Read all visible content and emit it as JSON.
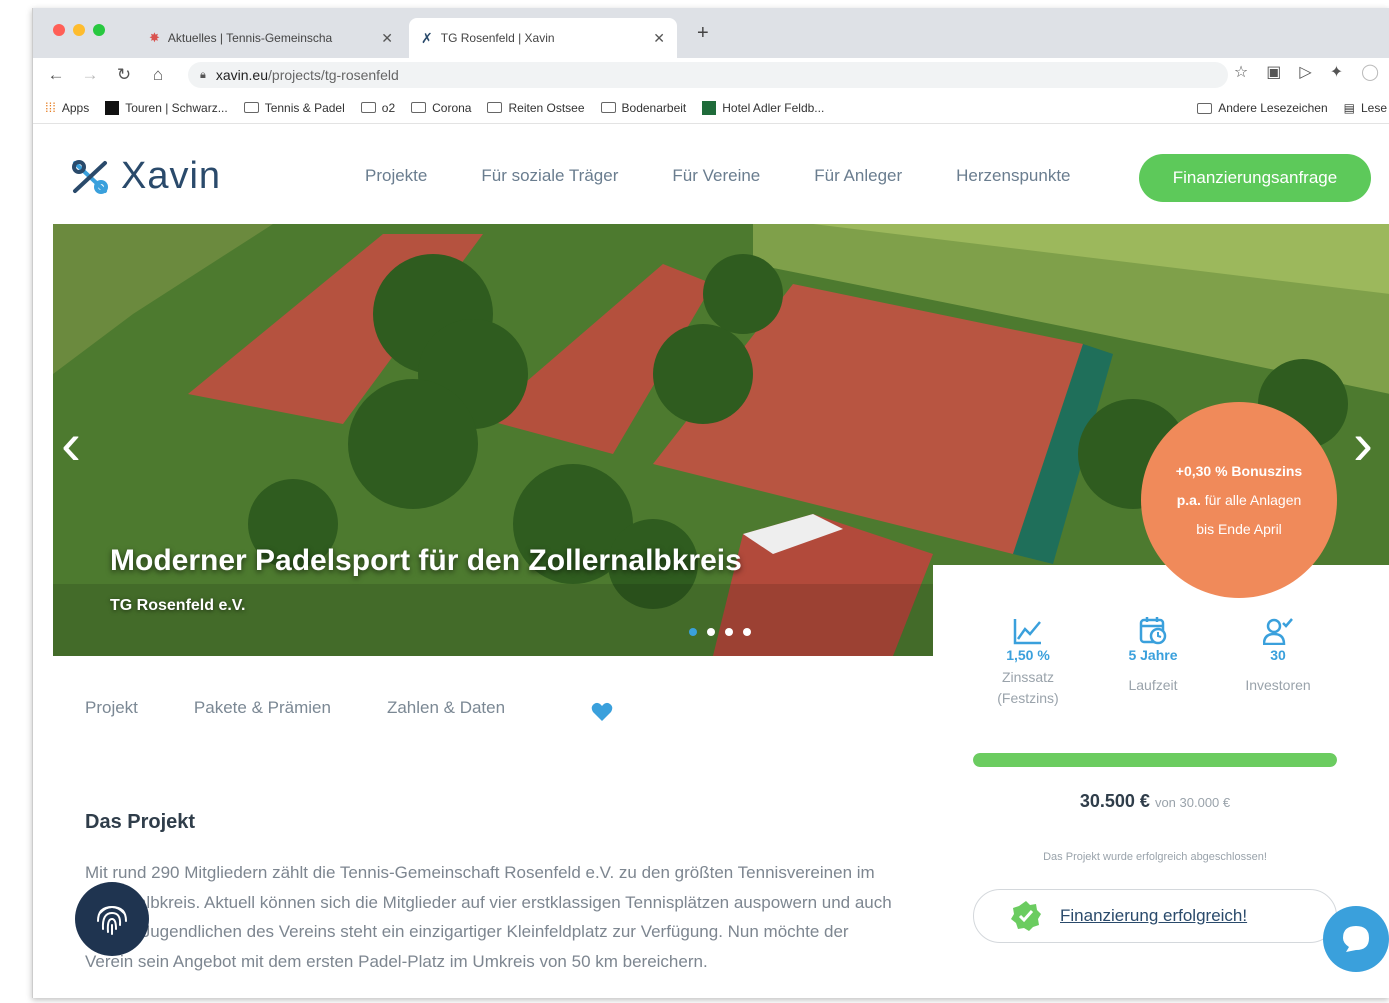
{
  "browser": {
    "tabs": [
      {
        "title": "Aktuelles | Tennis-Gemeinscha"
      },
      {
        "title": "TG Rosenfeld | Xavin"
      }
    ],
    "new_tab": "+",
    "url_host": "xavin.eu",
    "url_path": "/projects/tg-rosenfeld",
    "bookmarks": [
      "Apps",
      "Touren | Schwarz...",
      "Tennis & Padel",
      "o2",
      "Corona",
      "Reiten Ostsee",
      "Bodenarbeit",
      "Hotel Adler Feldb..."
    ],
    "bookmarks_right": [
      "Andere Lesezeichen",
      "Lese"
    ]
  },
  "site": {
    "logo": "Xavin",
    "nav": [
      "Projekte",
      "Für soziale Träger",
      "Für Vereine",
      "Für Anleger",
      "Herzenspunkte"
    ],
    "cta": "Finanzierungsanfrage",
    "accent": "#5dc95a",
    "brand": "#2a4a6b",
    "highlight": "#3aa0dc"
  },
  "hero": {
    "title": "Moderner Padelsport für den Zollernalbkreis",
    "subtitle": "TG Rosenfeld e.V.",
    "slides": 4,
    "active_slide": 1
  },
  "badge": {
    "line1": "+0,30 % Bonuszins",
    "line2_bold": "p.a.",
    "line2_rest": " für alle Anlagen",
    "line3": "bis Ende April"
  },
  "project_tabs": [
    "Projekt",
    "Pakete & Prämien",
    "Zahlen & Daten"
  ],
  "content": {
    "heading": "Das Projekt",
    "text": "Mit rund 290 Mitgliedern zählt die Tennis-Gemeinschaft Rosenfeld e.V. zu den größten Tennisvereinen im Zollernalbkreis. Aktuell können sich die Mitglieder auf vier erstklassigen Tennisplätzen auspowern und auch den 70 Jugendlichen des Vereins steht ein einzigartiger Kleinfeldplatz zur Verfügung. Nun möchte der Verein sein Angebot mit dem ersten Padel-Platz im Umkreis von 50 km bereichern."
  },
  "stats": [
    {
      "icon": "chart-line-icon",
      "value": "1,50 %",
      "label1": "Zinssatz",
      "label2": "(Festzins)"
    },
    {
      "icon": "calendar-clock-icon",
      "value": "5 Jahre",
      "label1": "Laufzeit",
      "label2": ""
    },
    {
      "icon": "user-check-icon",
      "value": "30",
      "label1": "Investoren",
      "label2": ""
    }
  ],
  "funding": {
    "progress": 1.0,
    "amount": "30.500 €",
    "of_text": "von 30.000 €",
    "status_text": "Das Projekt wurde erfolgreich abgeschlossen!",
    "success_label": "Finanzierung erfolgreich!"
  }
}
